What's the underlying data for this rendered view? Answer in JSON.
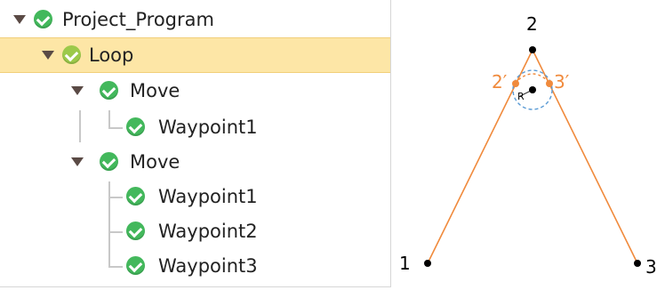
{
  "tree": {
    "root": {
      "label": "Project_Program"
    },
    "loop": {
      "label": "Loop"
    },
    "move1": {
      "label": "Move",
      "waypoints": [
        "Waypoint1"
      ]
    },
    "move2": {
      "label": "Move",
      "waypoints": [
        "Waypoint1",
        "Waypoint2",
        "Waypoint3"
      ]
    }
  },
  "diagram": {
    "point_labels": {
      "p1": "1",
      "p2": "2",
      "p3": "3",
      "p2_prime": "2′",
      "p3_prime": "3′",
      "radius": "R"
    },
    "colors": {
      "path": "#f08a3c",
      "blend_circle": "#5b9bd5",
      "point": "#000000"
    }
  },
  "colors": {
    "selected_row": "#fde6a6",
    "check_green": "#43b85c",
    "check_muted": "#9cc94a",
    "caret": "#5a4a45"
  }
}
